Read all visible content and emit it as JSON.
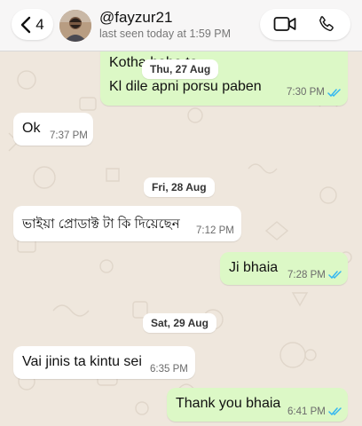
{
  "header": {
    "back_count": "4",
    "contact_name": "@fayzur21",
    "last_seen": "last seen today at 1:59 PM"
  },
  "dates": {
    "thu": "Thu, 27 Aug",
    "fri": "Fri, 28 Aug",
    "sat": "Sat, 29 Aug"
  },
  "messages": [
    {
      "direction": "out",
      "text": "Kotha hobe to",
      "time": ""
    },
    {
      "direction": "out",
      "text": "Kl dile apni porsu paben",
      "time": "7:30 PM",
      "status": "read"
    },
    {
      "direction": "in",
      "text": "Ok",
      "time": "7:37 PM"
    },
    {
      "direction": "in",
      "text": "ভাইয়া প্রোডাক্ট টা কি দিয়েছেন",
      "time": "7:12 PM"
    },
    {
      "direction": "out",
      "text": "Ji bhaia",
      "time": "7:28 PM",
      "status": "read"
    },
    {
      "direction": "in",
      "text": "Vai jinis ta kintu sei",
      "time": "6:35 PM"
    },
    {
      "direction": "out",
      "text": "Thank you bhaia",
      "time": "6:41 PM",
      "status": "read"
    }
  ],
  "colors": {
    "outgoing_bubble": "#dcf8c6",
    "incoming_bubble": "#ffffff",
    "read_ticks": "#34b7f1",
    "wallpaper": "#efe7dd"
  },
  "icons": [
    "chevron-left-icon",
    "video-call-icon",
    "phone-icon",
    "double-check-icon"
  ]
}
